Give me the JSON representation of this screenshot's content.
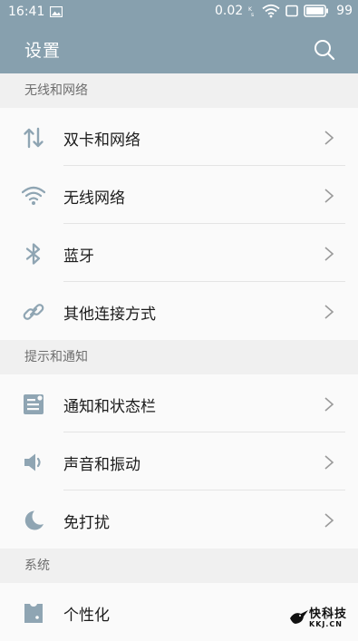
{
  "status_bar": {
    "time": "16:41",
    "net_speed": "0.02",
    "battery": "99"
  },
  "header": {
    "title": "设置"
  },
  "sections": [
    {
      "title": "无线和网络",
      "items": [
        {
          "label": "双卡和网络",
          "icon": "dual-sim-arrows-icon"
        },
        {
          "label": "无线网络",
          "icon": "wifi-icon"
        },
        {
          "label": "蓝牙",
          "icon": "bluetooth-icon"
        },
        {
          "label": "其他连接方式",
          "icon": "link-icon"
        }
      ]
    },
    {
      "title": "提示和通知",
      "items": [
        {
          "label": "通知和状态栏",
          "icon": "notification-icon"
        },
        {
          "label": "声音和振动",
          "icon": "speaker-icon"
        },
        {
          "label": "免打扰",
          "icon": "moon-icon"
        }
      ]
    },
    {
      "title": "系统",
      "items": [
        {
          "label": "个性化",
          "icon": "personalization-icon"
        }
      ]
    }
  ],
  "watermark": {
    "name": "快科技",
    "domain": "KKJ.CN"
  },
  "colors": {
    "header_bg": "#87a0ae",
    "icon": "#8fa5b3",
    "section_bg": "#f0f0f0",
    "list_bg": "#fafafa"
  }
}
